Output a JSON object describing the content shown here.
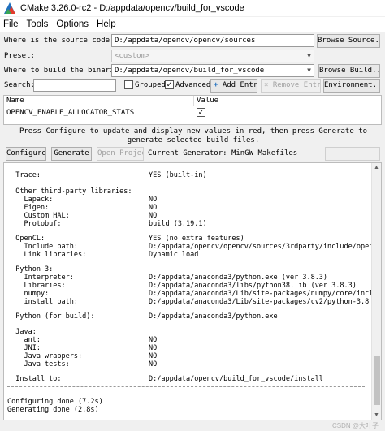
{
  "window": {
    "title": "CMake 3.26.0-rc2 - D:/appdata/opencv/build_for_vscode"
  },
  "menu": [
    "File",
    "Tools",
    "Options",
    "Help"
  ],
  "source": {
    "label": "Where is the source code:",
    "value": "D:/appdata/opencv/opencv/sources",
    "button": "Browse Source..."
  },
  "preset": {
    "label": "Preset:",
    "value": "<custom>"
  },
  "build": {
    "label": "Where to build the binaries:",
    "value": "D:/appdata/opencv/build_for_vscode",
    "button": "Browse Build..."
  },
  "toolbar": {
    "search_label": "Search:",
    "search_value": "",
    "grouped_label": "Grouped",
    "grouped_checked": false,
    "advanced_label": "Advanced",
    "advanced_checked": true,
    "add_entry": "Add Entry",
    "remove_entry": "Remove Entry",
    "environment": "Environment..."
  },
  "cache_table": {
    "columns": [
      "Name",
      "Value"
    ],
    "rows": [
      {
        "name": "OPENCV_ENABLE_ALLOCATOR_STATS",
        "value_checked": true
      }
    ]
  },
  "info_text": "Press Configure to update and display new values in red, then press Generate to generate selected build files.",
  "actions": {
    "configure": "Configure",
    "generate": "Generate",
    "open_project": "Open Project",
    "current_generator_label": "Current Generator: MinGW Makefiles"
  },
  "output_lines": [
    "  Trace:                          YES (built-in)",
    "",
    "  Other third-party libraries:",
    "    Lapack:                       NO",
    "    Eigen:                        NO",
    "    Custom HAL:                   NO",
    "    Protobuf:                     build (3.19.1)",
    "",
    "  OpenCL:                         YES (no extra features)",
    "    Include path:                 D:/appdata/opencv/opencv/sources/3rdparty/include/openc",
    "    Link libraries:               Dynamic load",
    "",
    "  Python 3:",
    "    Interpreter:                  D:/appdata/anaconda3/python.exe (ver 3.8.3)",
    "    Libraries:                    D:/appdata/anaconda3/libs/python38.lib (ver 3.8.3)",
    "    numpy:                        D:/appdata/anaconda3/Lib/site-packages/numpy/core/inclu",
    "    install path:                 D:/appdata/anaconda3/Lib/site-packages/cv2/python-3.8",
    "",
    "  Python (for build):             D:/appdata/anaconda3/python.exe",
    "",
    "  Java:",
    "    ant:                          NO",
    "    JNI:                          NO",
    "    Java wrappers:                NO",
    "    Java tests:                   NO",
    "",
    "  Install to:                     D:/appdata/opencv/build_for_vscode/install",
    "-----------------------------------------------------------------",
    "",
    "Configuring done (7.2s)",
    "Generating done (2.8s)"
  ],
  "watermark": "CSDN @大叶子"
}
